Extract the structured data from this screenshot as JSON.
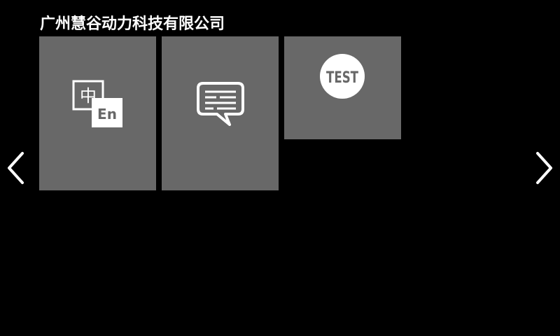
{
  "header": {
    "title": "广州慧谷动力科技有限公司"
  },
  "tiles": [
    {
      "icon": "chinese-english-translate-icon",
      "glyph_zh": "中",
      "glyph_en": "En"
    },
    {
      "icon": "message-bubble-icon"
    },
    {
      "icon": "test-badge-icon",
      "badge_text": "TEST"
    }
  ],
  "navigation": {
    "prev_icon": "chevron-left-icon",
    "next_icon": "chevron-right-icon"
  },
  "colors": {
    "background": "#000000",
    "tile": "#686868",
    "foreground": "#ffffff"
  }
}
